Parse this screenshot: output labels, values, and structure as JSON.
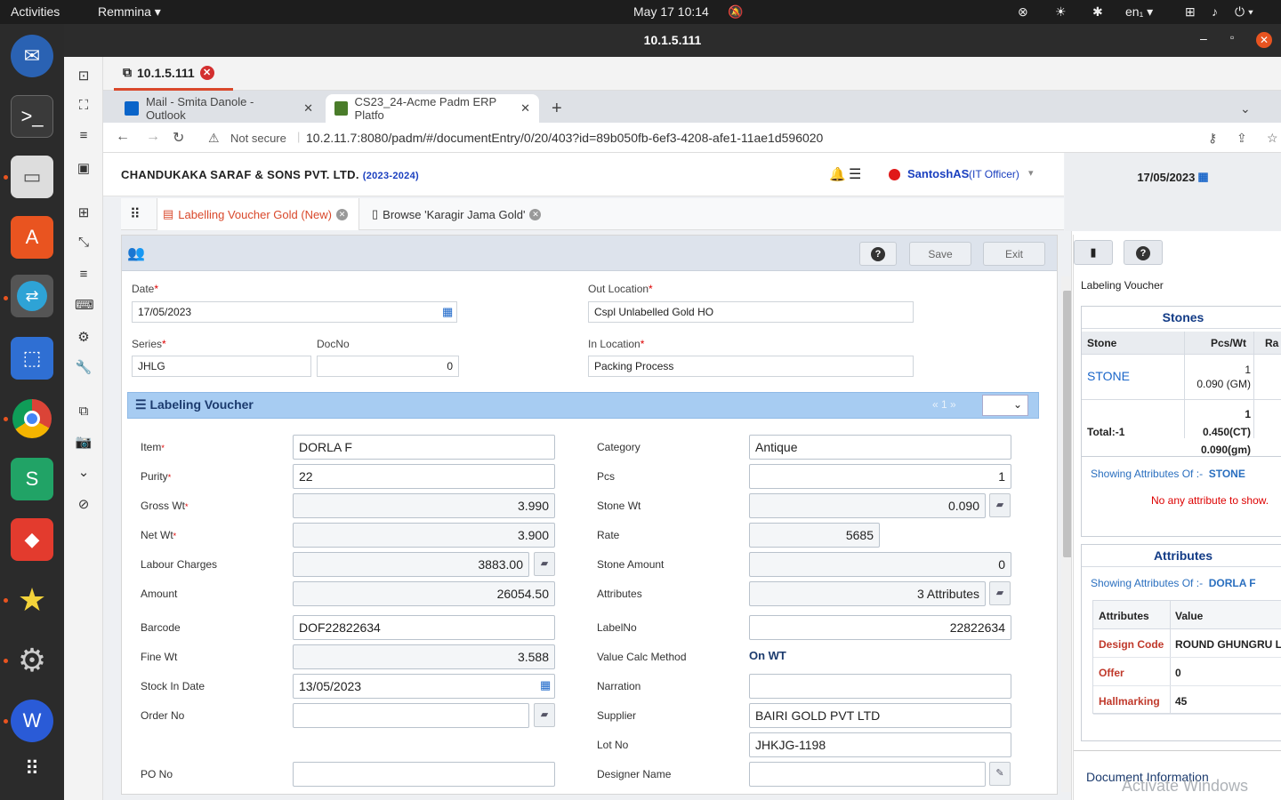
{
  "os": {
    "activities": "Activities",
    "app_menu": "Remmina ▾",
    "clock": "May 17  10:14",
    "lang": "en₁ ▾"
  },
  "remmina": {
    "window_title": "10.1.5.111",
    "tab_label": "10.1.5.111"
  },
  "browser": {
    "tabs": [
      {
        "label": "Mail - Smita Danole - Outlook"
      },
      {
        "label": "CS23_24-Acme Padm ERP Platfo"
      }
    ],
    "new_tab": "+",
    "not_secure": "Not secure",
    "url": "10.2.11.7:8080/padm/#/documentEntry/0/20/403?id=89b050fb-6ef3-4208-afe1-11ae1d596020"
  },
  "app": {
    "company": "CHANDUKAKA SARAF & SONS PVT. LTD.",
    "year": "(2023-2024)",
    "user": "SantoshAS",
    "role": "(IT Officer)",
    "date": "17/05/2023",
    "tabs": [
      {
        "label": "Labelling Voucher Gold (New)"
      },
      {
        "label": "Browse 'Karagir Jama Gold'"
      }
    ],
    "toolbar": {
      "save": "Save",
      "exit": "Exit"
    }
  },
  "form": {
    "date_label": "Date",
    "date_value": "17/05/2023",
    "out_loc_label": "Out Location",
    "out_loc_value": "Cspl Unlabelled Gold HO",
    "series_label": "Series",
    "series_value": "JHLG",
    "docno_label": "DocNo",
    "docno_value": "0",
    "in_loc_label": "In Location",
    "in_loc_value": "Packing Process"
  },
  "grid": {
    "title": "Labeling Voucher",
    "pager": "«  1  »"
  },
  "left_fields": [
    {
      "label": "Item",
      "value": "DORLA F",
      "req": "*",
      "align": "l"
    },
    {
      "label": "Purity",
      "value": "22",
      "req": "*",
      "align": "l"
    },
    {
      "label": "Gross Wt",
      "value": "3.990",
      "req": "*",
      "align": "r"
    },
    {
      "label": "Net Wt",
      "value": "3.900",
      "req": "*",
      "align": "r"
    },
    {
      "label": "Labour Charges",
      "value": "3883.00",
      "req": "",
      "align": "r"
    },
    {
      "label": "Amount",
      "value": "26054.50",
      "req": "",
      "align": "r"
    },
    {
      "label": "Barcode",
      "value": "DOF22822634",
      "req": "",
      "align": "l"
    },
    {
      "label": "Fine Wt",
      "value": "3.588",
      "req": "",
      "align": "r"
    },
    {
      "label": "Stock In Date",
      "value": "13/05/2023",
      "req": "",
      "align": "l"
    },
    {
      "label": "Order No",
      "value": "",
      "req": "",
      "align": "l"
    },
    {
      "label": "PO No",
      "value": "",
      "req": "",
      "align": "l"
    }
  ],
  "right_fields": [
    {
      "label": "Category",
      "value": "Antique"
    },
    {
      "label": "Pcs",
      "value": "1"
    },
    {
      "label": "Stone Wt",
      "value": "0.090"
    },
    {
      "label": "Rate",
      "value": "5685"
    },
    {
      "label": "Stone Amount",
      "value": "0"
    },
    {
      "label": "Attributes",
      "value": "3 Attributes"
    },
    {
      "label": "LabelNo",
      "value": "22822634"
    },
    {
      "label": "Value Calc Method",
      "value": "On WT"
    },
    {
      "label": "Narration",
      "value": ""
    },
    {
      "label": "Supplier",
      "value": "BAIRI GOLD PVT LTD"
    },
    {
      "label": "Lot No",
      "value": "JHKJG-1198"
    },
    {
      "label": "Designer Name",
      "value": ""
    }
  ],
  "side": {
    "heading": "Labeling Voucher",
    "stones_title": "Stones",
    "stones_cols": [
      "Stone",
      "Pcs/Wt",
      "Ra"
    ],
    "stone_name": "STONE",
    "stone_pcs": "1",
    "stone_wt": "0.090 (GM)",
    "total_label": "Total:-1",
    "total_pcs": "1",
    "total_ct": "0.450(CT)",
    "total_gm": "0.090(gm)",
    "showing1": "Showing Attributes Of :-",
    "showing1_item": "STONE",
    "no_attr": "No any attribute to show.",
    "attr_title": "Attributes",
    "showing2": "Showing Attributes Of :-",
    "showing2_item": "DORLA F",
    "attr_cols": [
      "Attributes",
      "Value"
    ],
    "attr_rows": [
      {
        "k": "Design Code",
        "v": "ROUND GHUNGRU L"
      },
      {
        "k": "Offer",
        "v": "0"
      },
      {
        "k": "Hallmarking",
        "v": "45"
      }
    ],
    "doc_info": "Document Information",
    "watermark": "Activate Windows"
  }
}
